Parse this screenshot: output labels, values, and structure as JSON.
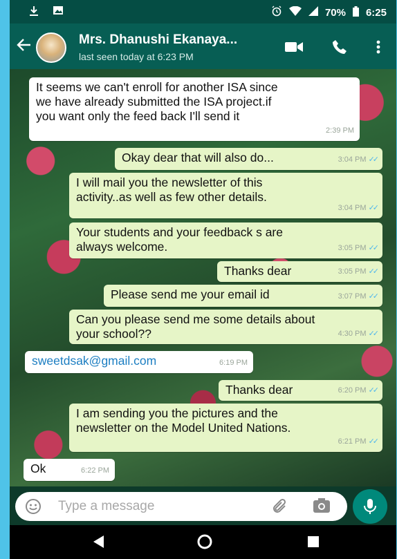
{
  "status_bar": {
    "battery": "70%",
    "time": "6:25"
  },
  "header": {
    "contact_name": "Mrs. Dhanushi Ekanaya...",
    "last_seen": "last seen today at 6:23 PM"
  },
  "messages": [
    {
      "direction": "in",
      "lines": [
        "It seems we can't enroll for another ISA since",
        "we have already submitted the ISA project.if",
        "you want only the feed back I'll send it"
      ],
      "time": "2:39 PM"
    },
    {
      "direction": "out",
      "lines": [
        "Okay dear that will also do..."
      ],
      "time": "3:04 PM"
    },
    {
      "direction": "out",
      "lines": [
        "I will mail you the newsletter of this",
        "activity..as well as few other details."
      ],
      "time": "3:04 PM"
    },
    {
      "direction": "out",
      "lines": [
        "Your students and your feedback s are",
        "always welcome."
      ],
      "time": "3:05 PM"
    },
    {
      "direction": "out",
      "lines": [
        "Thanks dear"
      ],
      "time": "3:05 PM"
    },
    {
      "direction": "out",
      "lines": [
        "Please send me your email id"
      ],
      "time": "3:07 PM"
    },
    {
      "direction": "out",
      "lines": [
        "Can you please send me some details about",
        "your school??"
      ],
      "time": "4:30 PM"
    },
    {
      "direction": "in",
      "lines": [
        "sweetdsak@gmail.com"
      ],
      "time": "6:19 PM",
      "link": true
    },
    {
      "direction": "out",
      "lines": [
        "Thanks dear"
      ],
      "time": "6:20 PM"
    },
    {
      "direction": "out",
      "lines": [
        "I am sending you the pictures and  the",
        "newsletter on the Model United Nations."
      ],
      "time": "6:21 PM"
    },
    {
      "direction": "in",
      "lines": [
        "Ok"
      ],
      "time": "6:22 PM"
    }
  ],
  "input": {
    "placeholder": "Type a message"
  },
  "icons": {
    "download": "download-icon",
    "image": "image-icon",
    "alarm": "alarm-icon",
    "wifi": "wifi-icon",
    "signal": "signal-icon",
    "battery": "battery-icon",
    "back": "back-arrow-icon",
    "video": "video-call-icon",
    "phone": "phone-call-icon",
    "menu": "more-vert-icon",
    "emoji": "emoji-icon",
    "attach": "paperclip-icon",
    "camera": "camera-icon",
    "mic": "mic-icon",
    "nav_back": "nav-back-icon",
    "nav_home": "nav-home-icon",
    "nav_recents": "nav-recents-icon"
  },
  "colors": {
    "header": "#075e54",
    "status_bar": "#054d44",
    "outgoing_bubble": "#e6f5c7",
    "incoming_bubble": "#ffffff",
    "tick": "#4fb6ec",
    "mic_button": "#00897b",
    "link": "#1c7ec2"
  }
}
